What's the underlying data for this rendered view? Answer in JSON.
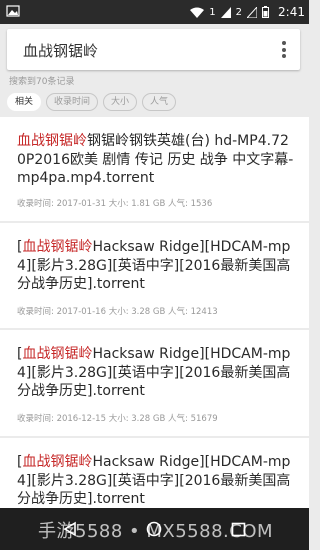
{
  "status_bar": {
    "sim1": "1",
    "sim2": "2",
    "time": "2:41"
  },
  "search": {
    "query": "血战钢锯岭"
  },
  "result_count": "搜索到70条记录",
  "sort_chips": [
    "相关",
    "收录时间",
    "大小",
    "人气"
  ],
  "results": [
    {
      "title_highlight": "血战钢锯岭",
      "title_rest": "钢锯岭钢铁英雄(台) hd-MP4.720P2016欧美 剧情 传记 历史 战争 中文字幕-mp4pa.mp4.torrent",
      "date_label": "收录时间:",
      "date": "2017-01-31",
      "size_label": "大小:",
      "size": "1.81 GB",
      "pop_label": "人气:",
      "popularity": "1536"
    },
    {
      "title_prefix": "[",
      "title_highlight": "血战钢锯岭",
      "title_rest": "Hacksaw Ridge][HDCAM-mp4][影片3.28G][英语中字][2016最新美国高分战争历史].torrent",
      "date_label": "收录时间:",
      "date": "2017-01-16",
      "size_label": "大小:",
      "size": "3.28 GB",
      "pop_label": "人气:",
      "popularity": "12413"
    },
    {
      "title_prefix": "[",
      "title_highlight": "血战钢锯岭",
      "title_rest": "Hacksaw Ridge][HDCAM-mp4][影片3.28G][英语中字][2016最新美国高分战争历史].torrent",
      "date_label": "收录时间:",
      "date": "2016-12-15",
      "size_label": "大小:",
      "size": "3.28 GB",
      "pop_label": "人气:",
      "popularity": "51679"
    },
    {
      "title_prefix": "[",
      "title_highlight": "血战钢锯岭",
      "title_rest": "Hacksaw Ridge][HDCAM-mp4][影片3.28G][英语中字][2016最新美国高分战争历史].torrent"
    }
  ],
  "watermark": "手游5588 • MX5588.COM",
  "colors": {
    "highlight": "#c62828",
    "status_bar": "#2b2b2b",
    "nav_bar": "#1f1f1f"
  }
}
